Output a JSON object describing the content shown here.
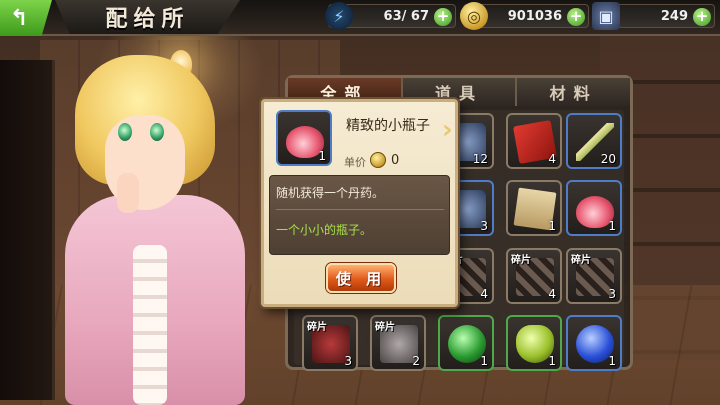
{
  "header": {
    "title": "配给所",
    "back_icon": "back-arrow-icon"
  },
  "resources": {
    "energy": {
      "icon": "lightning-icon",
      "value": "63/ 67"
    },
    "gold": {
      "icon": "coin-icon",
      "value": "901036"
    },
    "gems": {
      "icon": "gem-card-icon",
      "value": "249"
    }
  },
  "tabs": [
    {
      "label": "全部",
      "active": true
    },
    {
      "label": "道具",
      "active": false
    },
    {
      "label": "材料",
      "active": false
    }
  ],
  "grid": {
    "fragment_label": "碎片",
    "items": [
      {
        "art": "dice",
        "count": "",
        "border": "normal"
      },
      {
        "art": "misc",
        "count": "12",
        "border": "normal"
      },
      {
        "art": "redbook",
        "count": "4",
        "border": "normal"
      },
      {
        "art": "sword",
        "count": "20",
        "border": "blue"
      },
      {
        "art": "misc",
        "count": "",
        "border": "blue"
      },
      {
        "art": "blue-flask",
        "count": "3",
        "border": "blue"
      },
      {
        "art": "scroll",
        "count": "1",
        "border": "normal"
      },
      {
        "art": "potion",
        "count": "1",
        "border": "blue"
      },
      {
        "art": "cross",
        "count": "",
        "border": "normal",
        "fragment": true
      },
      {
        "art": "cross",
        "count": "4",
        "border": "normal",
        "fragment": true
      },
      {
        "art": "cross",
        "count": "4",
        "border": "normal",
        "fragment": true
      },
      {
        "art": "cross",
        "count": "3",
        "border": "normal",
        "fragment": true
      },
      {
        "art": "frag-red",
        "count": "3",
        "border": "normal",
        "fragment": true
      },
      {
        "art": "frag-gray",
        "count": "2",
        "border": "normal",
        "fragment": true
      },
      {
        "art": "green-gem",
        "count": "1",
        "border": "green"
      },
      {
        "art": "lime-gem",
        "count": "1",
        "border": "green"
      },
      {
        "art": "blue-gem",
        "count": "1",
        "border": "blue"
      }
    ]
  },
  "detail": {
    "name": "精致的小瓶子",
    "icon": "potion-bottle-icon",
    "icon_count": "1",
    "price_label": "单价",
    "price_value": "0",
    "description": "随机获得一个丹药。",
    "flavor": "一个小小的瓶子。",
    "use_button": "使 用"
  },
  "colors": {
    "accent_green": "#4fa84a",
    "accent_blue": "#4f7cc8",
    "button_orange": "#e05a1a",
    "flavor_text": "#a8e048"
  }
}
